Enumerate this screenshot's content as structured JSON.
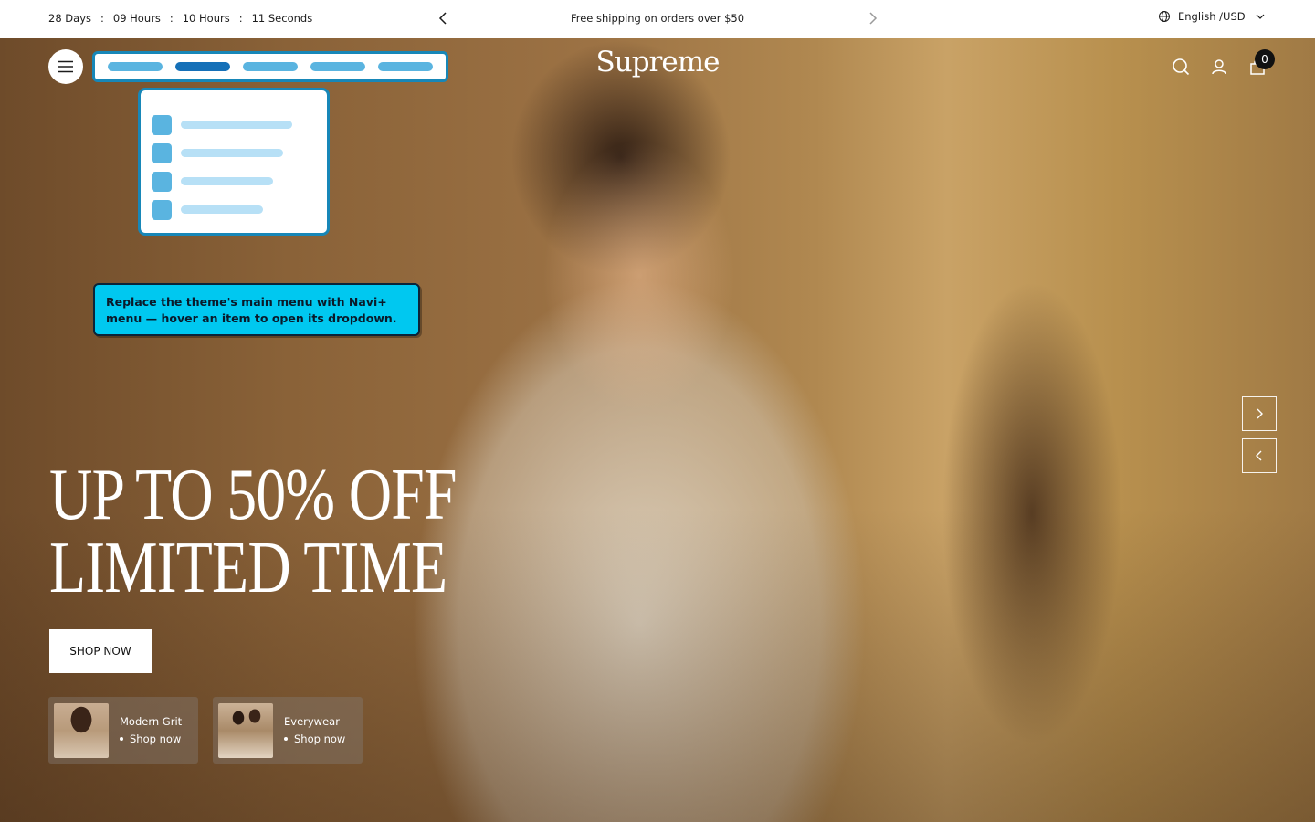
{
  "announcement": {
    "countdown": {
      "days": "28 Days",
      "hours_a": "09 Hours",
      "hours_b": "10 Hours",
      "seconds": "11 Seconds",
      "separator": ":"
    },
    "message": "Free shipping on orders over $50",
    "locale": "English /USD"
  },
  "header": {
    "logo": "Supreme",
    "cart_count": "0"
  },
  "overlay": {
    "tooltip": "Replace the theme's main menu with Navi+ menu — hover an item to open its dropdown.",
    "nav_pills": 5,
    "active_pill": 1
  },
  "hero": {
    "headline_line1": "UP TO 50% OFF",
    "headline_line2": "LIMITED TIME",
    "cta": "SHOP NOW"
  },
  "collections": [
    {
      "name": "Modern Grit",
      "link": "Shop now"
    },
    {
      "name": "Everywear",
      "link": "Shop now"
    }
  ],
  "colors": {
    "overlay_accent": "#1787b8",
    "tooltip_bg": "#00c8f0",
    "pill": "#5ab4e0",
    "pill_active": "#1570b8"
  }
}
